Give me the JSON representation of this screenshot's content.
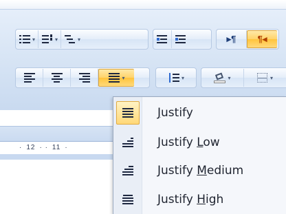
{
  "toolbar": {
    "row1": {
      "bullets_icon": "bullets-icon",
      "numbering_icon": "numbering-icon",
      "multilevel_icon": "multilevel-list-icon",
      "decrease_indent_icon": "decrease-indent-icon",
      "increase_indent_icon": "increase-indent-icon",
      "ltr_label": "▸¶",
      "rtl_label": "¶◂"
    },
    "row2": {
      "align_left_icon": "align-left-icon",
      "center_icon": "center-icon",
      "align_right_icon": "align-right-icon",
      "justify_icon": "justify-icon",
      "line_spacing_icon": "line-spacing-icon",
      "shading_icon": "shading-icon",
      "borders_icon": "borders-icon"
    }
  },
  "ruler": {
    "marks": [
      "12",
      "11"
    ]
  },
  "justify_menu": {
    "items": [
      {
        "prefix": "",
        "accel": "J",
        "rest": "ustify",
        "icon": "justify-icon",
        "active": true
      },
      {
        "prefix": "Justify ",
        "accel": "L",
        "rest": "ow",
        "icon": "justify-low-icon",
        "active": false
      },
      {
        "prefix": "Justify ",
        "accel": "M",
        "rest": "edium",
        "icon": "justify-medium-icon",
        "active": false
      },
      {
        "prefix": "Justify ",
        "accel": "H",
        "rest": "igh",
        "icon": "justify-high-icon",
        "active": false
      }
    ]
  }
}
